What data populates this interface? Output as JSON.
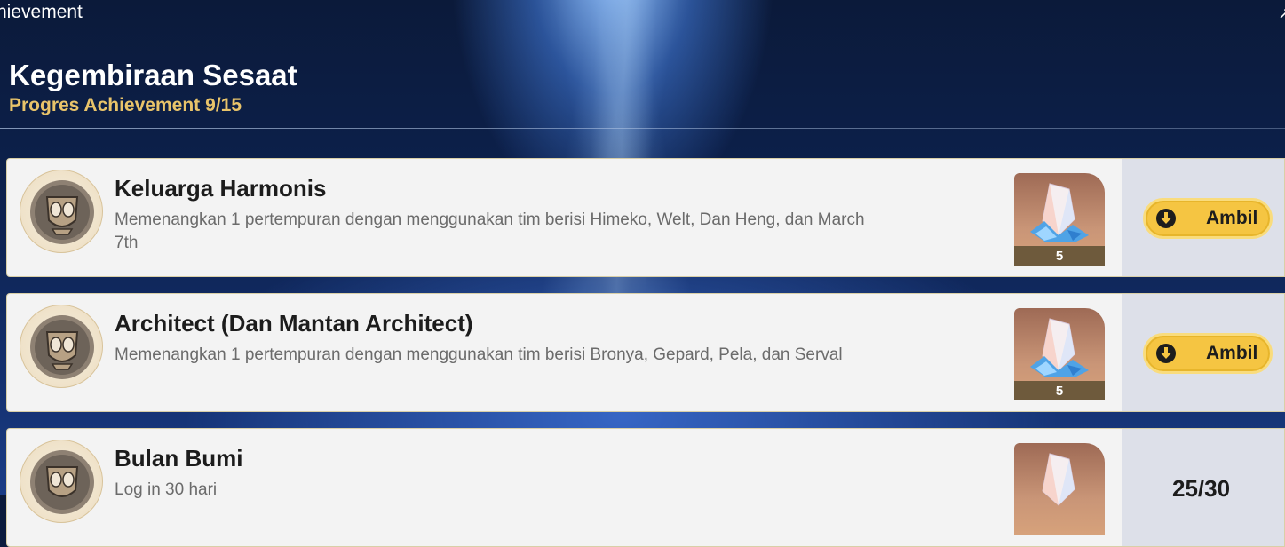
{
  "header": {
    "top_title": "hievement",
    "category_title": "Kegembiraan Sesaat",
    "progress_label": "Progres Achievement",
    "progress_value": "9/15"
  },
  "achievements": [
    {
      "title": "Keluarga Harmonis",
      "description": "Memenangkan 1 pertempuran dengan menggunakan tim berisi Himeko, Welt, Dan Heng, dan March 7th",
      "reward_count": "5",
      "action_label": "Ambil",
      "icon": "achievement-emblem-icon"
    },
    {
      "title": "Architect (Dan Mantan Architect)",
      "description": "Memenangkan 1 pertempuran dengan menggunakan tim berisi Bronya, Gepard, Pela, dan Serval",
      "reward_count": "5",
      "action_label": "Ambil",
      "icon": "achievement-emblem-icon"
    },
    {
      "title": "Bulan Bumi",
      "description": "Log in 30 hari",
      "progress": "25/30",
      "icon": "achievement-emblem-icon"
    }
  ],
  "colors": {
    "accent_gold": "#e9c46a",
    "button_yellow": "#f5c542",
    "card_bg": "#f3f3f3"
  }
}
